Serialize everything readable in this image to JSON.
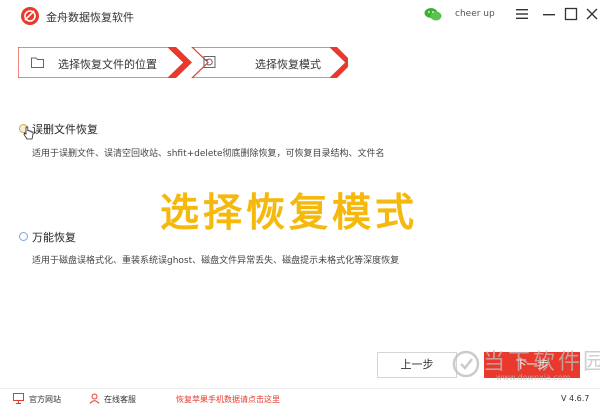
{
  "app": {
    "title": "金舟数据恢复软件",
    "user_name": "cheer up",
    "brand_color": "#e8392c"
  },
  "window_controls": {
    "menu": "menu-icon",
    "minimize": "minimize-icon",
    "maximize": "maximize-icon",
    "close": "close-icon"
  },
  "steps": [
    {
      "label": "选择恢复文件的位置",
      "icon": "folder-icon"
    },
    {
      "label": "选择恢复模式",
      "icon": "restore-icon"
    }
  ],
  "options": [
    {
      "label": "误删文件恢复",
      "description": "适用于误删文件、误清空回收站、shfit+delete彻底删除恢复，可恢复目录结构、文件名",
      "selected": true
    },
    {
      "label": "万能恢复",
      "description": "适用于磁盘误格式化、重装系统误ghost、磁盘文件异常丢失、磁盘提示未格式化等深度恢复",
      "selected": false
    }
  ],
  "overlay_title": "选择恢复模式",
  "buttons": {
    "prev": "上一步",
    "next": "下一步"
  },
  "watermark": {
    "text": "当下软件园",
    "url": "www.downxia.com"
  },
  "footer": {
    "website": "官方网站",
    "support": "在线客服",
    "promo": "恢复苹果手机数据请点击这里",
    "version": "V 4.6.7"
  }
}
